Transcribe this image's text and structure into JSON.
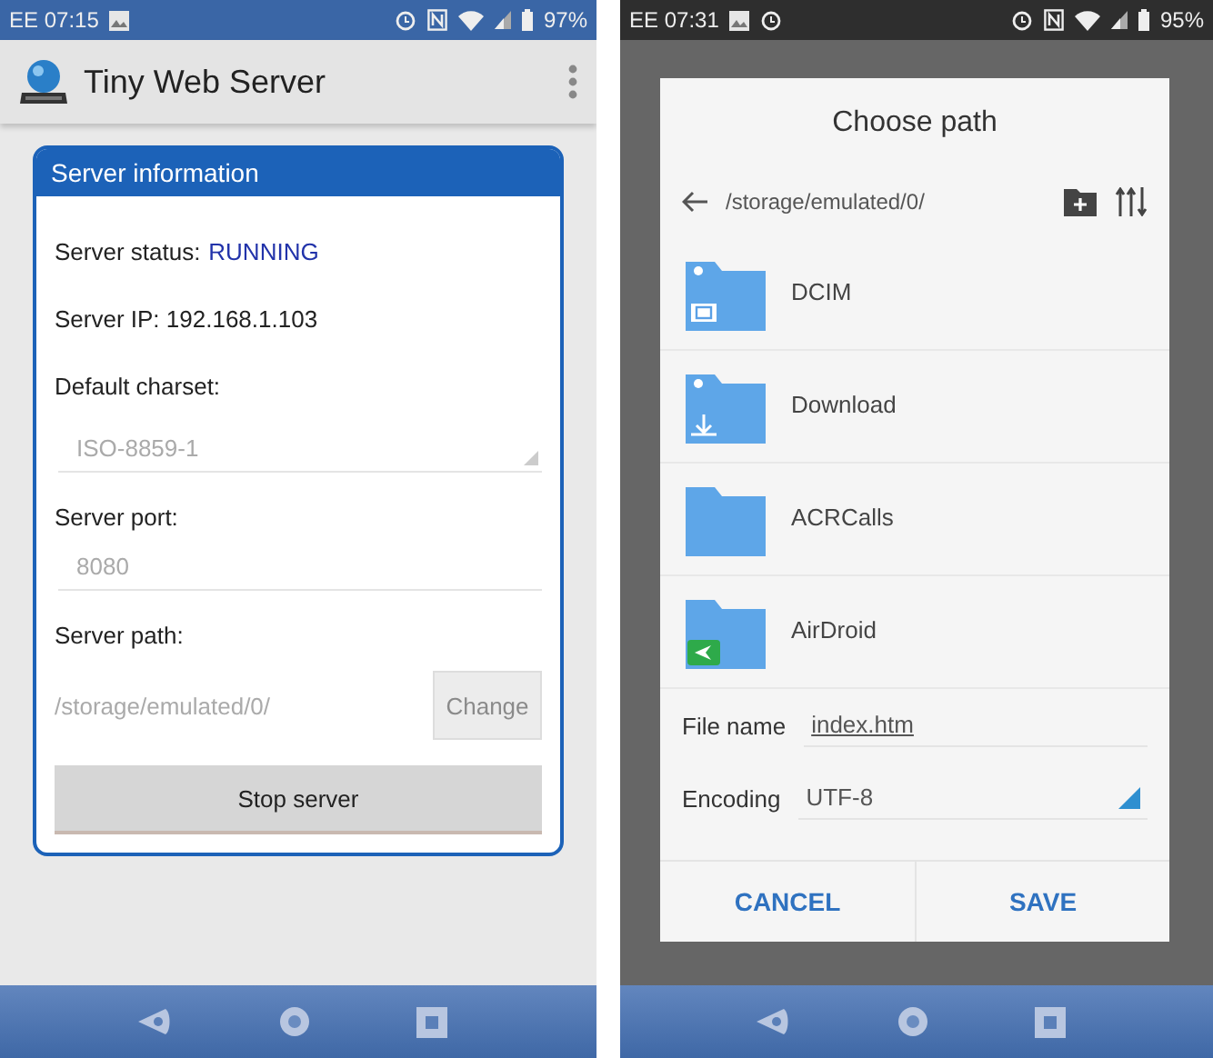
{
  "left_screen": {
    "status_bar": {
      "clock": "EE 07:15",
      "notification_icons": [
        {
          "kind": "image"
        }
      ],
      "battery": "97%"
    },
    "app_bar": {
      "title": "Tiny Web Server"
    },
    "card": {
      "title": "Server information",
      "status_label": "Server status:",
      "status_value": "RUNNING",
      "ip": "Server IP: 192.168.1.103",
      "charset": {
        "label": "Default charset:",
        "value": "ISO-8859-1",
        "disabled": true
      },
      "port": {
        "label": "Server port:",
        "value": "8080",
        "disabled": true
      },
      "path": {
        "label": "Server path:",
        "value": "/storage/emulated/0/",
        "disabled": true
      },
      "change_button": {
        "label": "Change",
        "disabled": true
      },
      "stop_button": "Stop server"
    }
  },
  "right_screen": {
    "status_bar": {
      "clock": "EE 07:31",
      "notification_icons": [
        {
          "kind": "image"
        },
        {
          "kind": "alarm"
        }
      ],
      "battery": "95%"
    },
    "dialog": {
      "title": "Choose path",
      "path": "/storage/emulated/0/",
      "folders": [
        {
          "name": "DCIM",
          "kind": "camera"
        },
        {
          "name": "Download",
          "kind": "download"
        },
        {
          "name": "ACRCalls",
          "kind": "plain"
        },
        {
          "name": "AirDroid",
          "kind": "airdroid"
        }
      ],
      "file_name_label": "File name",
      "file_name": "index.htm",
      "encoding_label": "Encoding",
      "encoding": "UTF-8",
      "buttons": [
        "CANCEL",
        "SAVE"
      ]
    }
  }
}
